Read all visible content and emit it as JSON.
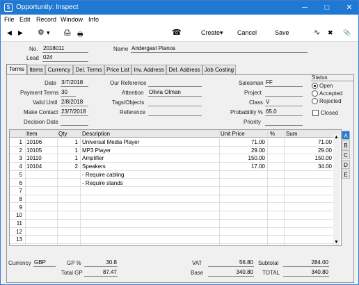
{
  "window": {
    "title": "Opportunity: Inspect",
    "minimize": "─",
    "maximize": "□",
    "close": "✕",
    "app_icon": "$"
  },
  "menu": [
    "File",
    "Edit",
    "Record",
    "Window",
    "Info"
  ],
  "toolbar": {
    "prev": "◀",
    "next": "▶",
    "gear": "⚙",
    "gear_caret": "▾",
    "print": "🖨",
    "preview": "🖶",
    "phone": "☎",
    "create": "Create",
    "create_caret": "▾",
    "cancel": "Cancel",
    "save": "Save",
    "sparkline": "∿",
    "expand": "✖",
    "attach": "📎"
  },
  "header": {
    "no_label": "No.",
    "no_value": "2018011",
    "name_label": "Name",
    "name_value": "Andergast Pianos",
    "lead_label": "Lead",
    "lead_value": "024"
  },
  "tabs": [
    "Terms",
    "Items",
    "Currency",
    "Del. Terms",
    "Price List",
    "Inv. Address",
    "Del. Address",
    "Job Costing"
  ],
  "terms": {
    "date_label": "Date",
    "date": "3/7/2018",
    "payment_terms_label": "Payment Terms",
    "payment_terms": "30",
    "valid_until_label": "Valid Until",
    "valid_until": "2/8/2018",
    "make_contact_label": "Make Contact",
    "make_contact": "23/7/2018",
    "decision_date_label": "Decision Date",
    "decision_date": "",
    "our_reference_label": "Our Reference",
    "our_reference": "",
    "attention_label": "Attention",
    "attention": "Olivia Olman",
    "tags_label": "Tags/Objects",
    "tags": "",
    "reference_label": "Reference",
    "reference": "",
    "salesman_label": "Salesman",
    "salesman": "FF",
    "project_label": "Project",
    "project": "",
    "class_label": "Class",
    "class": "V",
    "probability_label": "Probability %",
    "probability": "65.0",
    "priority_label": "Priority",
    "priority": ""
  },
  "status": {
    "label": "Status",
    "options": [
      "Open",
      "Accepted",
      "Rejected"
    ],
    "selected": "Open",
    "closed_label": "Closed",
    "closed_checked": false
  },
  "grid": {
    "headers": {
      "item": "Item",
      "qty": "Qty",
      "description": "Description",
      "unit_price": "Unit Price",
      "pct": "%",
      "sum": "Sum"
    },
    "rows": [
      {
        "n": "1",
        "item": "10106",
        "qty": "1",
        "desc": "Universal Media Player",
        "price": "71.00",
        "pct": "",
        "sum": "71.00"
      },
      {
        "n": "2",
        "item": "10105",
        "qty": "1",
        "desc": "MP3 Player",
        "price": "29.00",
        "pct": "",
        "sum": "29.00"
      },
      {
        "n": "3",
        "item": "10110",
        "qty": "1",
        "desc": "Amplifier",
        "price": "150.00",
        "pct": "",
        "sum": "150.00"
      },
      {
        "n": "4",
        "item": "10104",
        "qty": "2",
        "desc": "Speakers",
        "price": "17.00",
        "pct": "",
        "sum": "34.00"
      },
      {
        "n": "5",
        "item": "",
        "qty": "",
        "desc": "- Require cabling",
        "price": "",
        "pct": "",
        "sum": ""
      },
      {
        "n": "6",
        "item": "",
        "qty": "",
        "desc": "- Require stands",
        "price": "",
        "pct": "",
        "sum": ""
      },
      {
        "n": "7",
        "item": "",
        "qty": "",
        "desc": "",
        "price": "",
        "pct": "",
        "sum": ""
      },
      {
        "n": "8",
        "item": "",
        "qty": "",
        "desc": "",
        "price": "",
        "pct": "",
        "sum": ""
      },
      {
        "n": "9",
        "item": "",
        "qty": "",
        "desc": "",
        "price": "",
        "pct": "",
        "sum": ""
      },
      {
        "n": "10",
        "item": "",
        "qty": "",
        "desc": "",
        "price": "",
        "pct": "",
        "sum": ""
      },
      {
        "n": "11",
        "item": "",
        "qty": "",
        "desc": "",
        "price": "",
        "pct": "",
        "sum": ""
      },
      {
        "n": "12",
        "item": "",
        "qty": "",
        "desc": "",
        "price": "",
        "pct": "",
        "sum": ""
      },
      {
        "n": "13",
        "item": "",
        "qty": "",
        "desc": "",
        "price": "",
        "pct": "",
        "sum": ""
      }
    ],
    "side_tabs": [
      "A",
      "B",
      "C",
      "D",
      "E"
    ],
    "scroll_up": "▲",
    "scroll_down": "▼"
  },
  "footer": {
    "currency_label": "Currency",
    "currency": "GBP",
    "gp_pct_label": "GP %",
    "gp_pct": "30.8",
    "total_gp_label": "Total GP",
    "total_gp": "87.47",
    "vat_label": "VAT",
    "vat": "56.80",
    "base_label": "Base",
    "base": "340.80",
    "subtotal_label": "Subtotal",
    "subtotal": "284.00",
    "total_label": "TOTAL",
    "total": "340.80"
  },
  "colors": {
    "titlebar": "#1f78d1",
    "active_side_tab": "#1f78d1"
  }
}
